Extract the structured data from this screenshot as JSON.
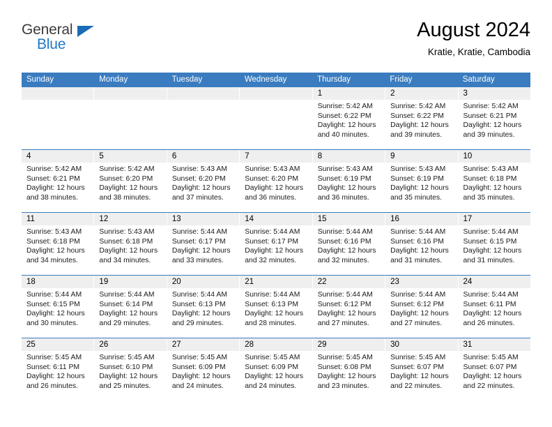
{
  "brand": {
    "name_part1": "General",
    "name_part2": "Blue",
    "logo_icon": "triangle-logo-icon"
  },
  "header": {
    "title": "August 2024",
    "location": "Kratie, Kratie, Cambodia"
  },
  "colors": {
    "header_blue": "#3a7cbf",
    "brand_blue": "#2079c7",
    "daynum_band": "#efefef"
  },
  "calendar": {
    "weekday_headers": [
      "Sunday",
      "Monday",
      "Tuesday",
      "Wednesday",
      "Thursday",
      "Friday",
      "Saturday"
    ],
    "weeks": [
      [
        {
          "day": "",
          "lines": []
        },
        {
          "day": "",
          "lines": []
        },
        {
          "day": "",
          "lines": []
        },
        {
          "day": "",
          "lines": []
        },
        {
          "day": "1",
          "lines": [
            "Sunrise: 5:42 AM",
            "Sunset: 6:22 PM",
            "Daylight: 12 hours",
            "and 40 minutes."
          ]
        },
        {
          "day": "2",
          "lines": [
            "Sunrise: 5:42 AM",
            "Sunset: 6:22 PM",
            "Daylight: 12 hours",
            "and 39 minutes."
          ]
        },
        {
          "day": "3",
          "lines": [
            "Sunrise: 5:42 AM",
            "Sunset: 6:21 PM",
            "Daylight: 12 hours",
            "and 39 minutes."
          ]
        }
      ],
      [
        {
          "day": "4",
          "lines": [
            "Sunrise: 5:42 AM",
            "Sunset: 6:21 PM",
            "Daylight: 12 hours",
            "and 38 minutes."
          ]
        },
        {
          "day": "5",
          "lines": [
            "Sunrise: 5:42 AM",
            "Sunset: 6:20 PM",
            "Daylight: 12 hours",
            "and 38 minutes."
          ]
        },
        {
          "day": "6",
          "lines": [
            "Sunrise: 5:43 AM",
            "Sunset: 6:20 PM",
            "Daylight: 12 hours",
            "and 37 minutes."
          ]
        },
        {
          "day": "7",
          "lines": [
            "Sunrise: 5:43 AM",
            "Sunset: 6:20 PM",
            "Daylight: 12 hours",
            "and 36 minutes."
          ]
        },
        {
          "day": "8",
          "lines": [
            "Sunrise: 5:43 AM",
            "Sunset: 6:19 PM",
            "Daylight: 12 hours",
            "and 36 minutes."
          ]
        },
        {
          "day": "9",
          "lines": [
            "Sunrise: 5:43 AM",
            "Sunset: 6:19 PM",
            "Daylight: 12 hours",
            "and 35 minutes."
          ]
        },
        {
          "day": "10",
          "lines": [
            "Sunrise: 5:43 AM",
            "Sunset: 6:18 PM",
            "Daylight: 12 hours",
            "and 35 minutes."
          ]
        }
      ],
      [
        {
          "day": "11",
          "lines": [
            "Sunrise: 5:43 AM",
            "Sunset: 6:18 PM",
            "Daylight: 12 hours",
            "and 34 minutes."
          ]
        },
        {
          "day": "12",
          "lines": [
            "Sunrise: 5:43 AM",
            "Sunset: 6:18 PM",
            "Daylight: 12 hours",
            "and 34 minutes."
          ]
        },
        {
          "day": "13",
          "lines": [
            "Sunrise: 5:44 AM",
            "Sunset: 6:17 PM",
            "Daylight: 12 hours",
            "and 33 minutes."
          ]
        },
        {
          "day": "14",
          "lines": [
            "Sunrise: 5:44 AM",
            "Sunset: 6:17 PM",
            "Daylight: 12 hours",
            "and 32 minutes."
          ]
        },
        {
          "day": "15",
          "lines": [
            "Sunrise: 5:44 AM",
            "Sunset: 6:16 PM",
            "Daylight: 12 hours",
            "and 32 minutes."
          ]
        },
        {
          "day": "16",
          "lines": [
            "Sunrise: 5:44 AM",
            "Sunset: 6:16 PM",
            "Daylight: 12 hours",
            "and 31 minutes."
          ]
        },
        {
          "day": "17",
          "lines": [
            "Sunrise: 5:44 AM",
            "Sunset: 6:15 PM",
            "Daylight: 12 hours",
            "and 31 minutes."
          ]
        }
      ],
      [
        {
          "day": "18",
          "lines": [
            "Sunrise: 5:44 AM",
            "Sunset: 6:15 PM",
            "Daylight: 12 hours",
            "and 30 minutes."
          ]
        },
        {
          "day": "19",
          "lines": [
            "Sunrise: 5:44 AM",
            "Sunset: 6:14 PM",
            "Daylight: 12 hours",
            "and 29 minutes."
          ]
        },
        {
          "day": "20",
          "lines": [
            "Sunrise: 5:44 AM",
            "Sunset: 6:13 PM",
            "Daylight: 12 hours",
            "and 29 minutes."
          ]
        },
        {
          "day": "21",
          "lines": [
            "Sunrise: 5:44 AM",
            "Sunset: 6:13 PM",
            "Daylight: 12 hours",
            "and 28 minutes."
          ]
        },
        {
          "day": "22",
          "lines": [
            "Sunrise: 5:44 AM",
            "Sunset: 6:12 PM",
            "Daylight: 12 hours",
            "and 27 minutes."
          ]
        },
        {
          "day": "23",
          "lines": [
            "Sunrise: 5:44 AM",
            "Sunset: 6:12 PM",
            "Daylight: 12 hours",
            "and 27 minutes."
          ]
        },
        {
          "day": "24",
          "lines": [
            "Sunrise: 5:44 AM",
            "Sunset: 6:11 PM",
            "Daylight: 12 hours",
            "and 26 minutes."
          ]
        }
      ],
      [
        {
          "day": "25",
          "lines": [
            "Sunrise: 5:45 AM",
            "Sunset: 6:11 PM",
            "Daylight: 12 hours",
            "and 26 minutes."
          ]
        },
        {
          "day": "26",
          "lines": [
            "Sunrise: 5:45 AM",
            "Sunset: 6:10 PM",
            "Daylight: 12 hours",
            "and 25 minutes."
          ]
        },
        {
          "day": "27",
          "lines": [
            "Sunrise: 5:45 AM",
            "Sunset: 6:09 PM",
            "Daylight: 12 hours",
            "and 24 minutes."
          ]
        },
        {
          "day": "28",
          "lines": [
            "Sunrise: 5:45 AM",
            "Sunset: 6:09 PM",
            "Daylight: 12 hours",
            "and 24 minutes."
          ]
        },
        {
          "day": "29",
          "lines": [
            "Sunrise: 5:45 AM",
            "Sunset: 6:08 PM",
            "Daylight: 12 hours",
            "and 23 minutes."
          ]
        },
        {
          "day": "30",
          "lines": [
            "Sunrise: 5:45 AM",
            "Sunset: 6:07 PM",
            "Daylight: 12 hours",
            "and 22 minutes."
          ]
        },
        {
          "day": "31",
          "lines": [
            "Sunrise: 5:45 AM",
            "Sunset: 6:07 PM",
            "Daylight: 12 hours",
            "and 22 minutes."
          ]
        }
      ]
    ]
  }
}
